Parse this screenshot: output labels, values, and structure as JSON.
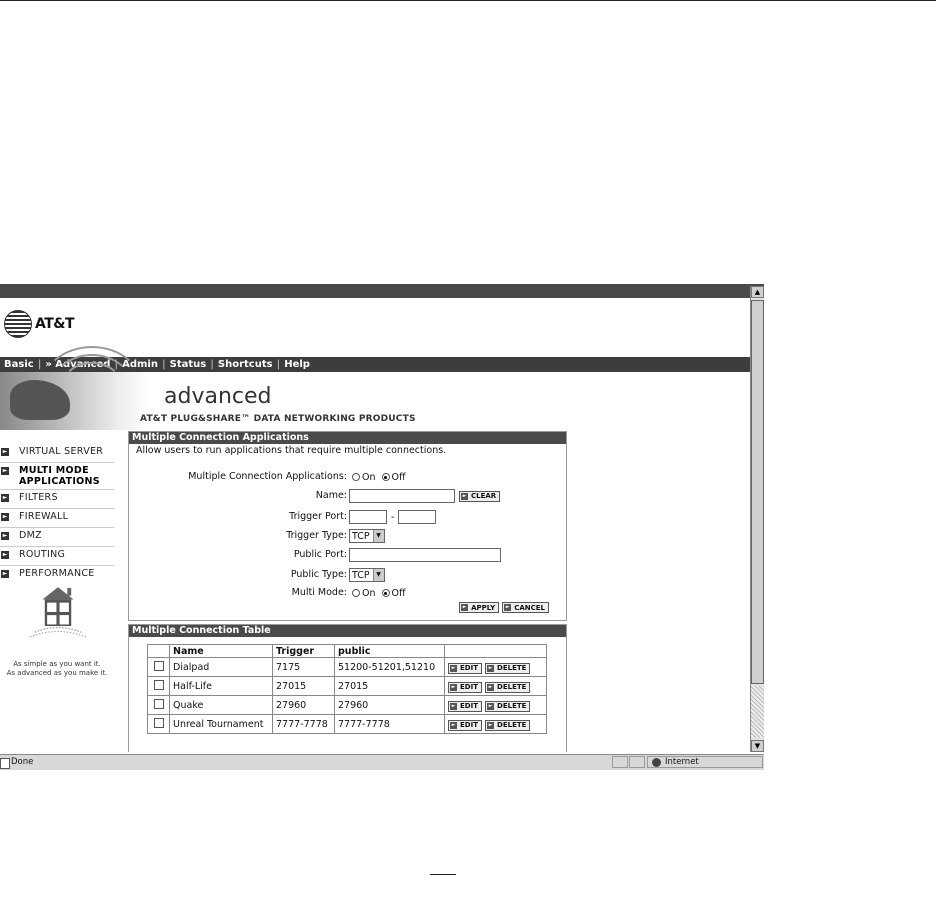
{
  "brand": {
    "logo_text": "AT&T"
  },
  "nav": {
    "items": [
      "Basic",
      "» Advanced",
      "Admin",
      "Status",
      "Shortcuts",
      "Help"
    ]
  },
  "banner": {
    "title": "advanced",
    "subtitle": "AT&T PLUG&SHARE™ DATA NETWORKING PRODUCTS"
  },
  "sidebar": {
    "items": [
      {
        "label": "VIRTUAL SERVER"
      },
      {
        "label": "MULTI MODE APPLICATIONS"
      },
      {
        "label": "FILTERS"
      },
      {
        "label": "FIREWALL"
      },
      {
        "label": "DMZ"
      },
      {
        "label": "ROUTING"
      },
      {
        "label": "PERFORMANCE"
      }
    ],
    "tagline_1": "As simple as you want it.",
    "tagline_2": "As advanced as you make it."
  },
  "form": {
    "heading": "Multiple Connection Applications",
    "description": "Allow users to run applications that require multiple connections.",
    "mca_label": "Multiple Connection Applications:",
    "on_label": "On",
    "off_label": "Off",
    "name_label": "Name:",
    "name_value": "",
    "clear_label": "CLEAR",
    "trigger_port_label": "Trigger Port:",
    "trigger_port_from": "",
    "trigger_port_to": "",
    "port_dash": "-",
    "trigger_type_label": "Trigger Type:",
    "trigger_type_value": "TCP",
    "public_port_label": "Public Port:",
    "public_port_value": "",
    "public_type_label": "Public Type:",
    "public_type_value": "TCP",
    "multi_mode_label": "Multi Mode:",
    "apply_label": "APPLY",
    "cancel_label": "CANCEL"
  },
  "table": {
    "heading": "Multiple Connection Table",
    "headers": [
      "Name",
      "Trigger",
      "public"
    ],
    "edit_label": "EDIT",
    "delete_label": "DELETE",
    "rows": [
      {
        "name": "Dialpad",
        "trigger": "7175",
        "public": "51200-51201,51210"
      },
      {
        "name": "Half-Life",
        "trigger": "27015",
        "public": "27015"
      },
      {
        "name": "Quake",
        "trigger": "27960",
        "public": "27960"
      },
      {
        "name": "Unreal Tournament",
        "trigger": "7777-7778",
        "public": "7777-7778"
      }
    ]
  },
  "statusbar": {
    "left": "Done",
    "zone": "Internet"
  }
}
